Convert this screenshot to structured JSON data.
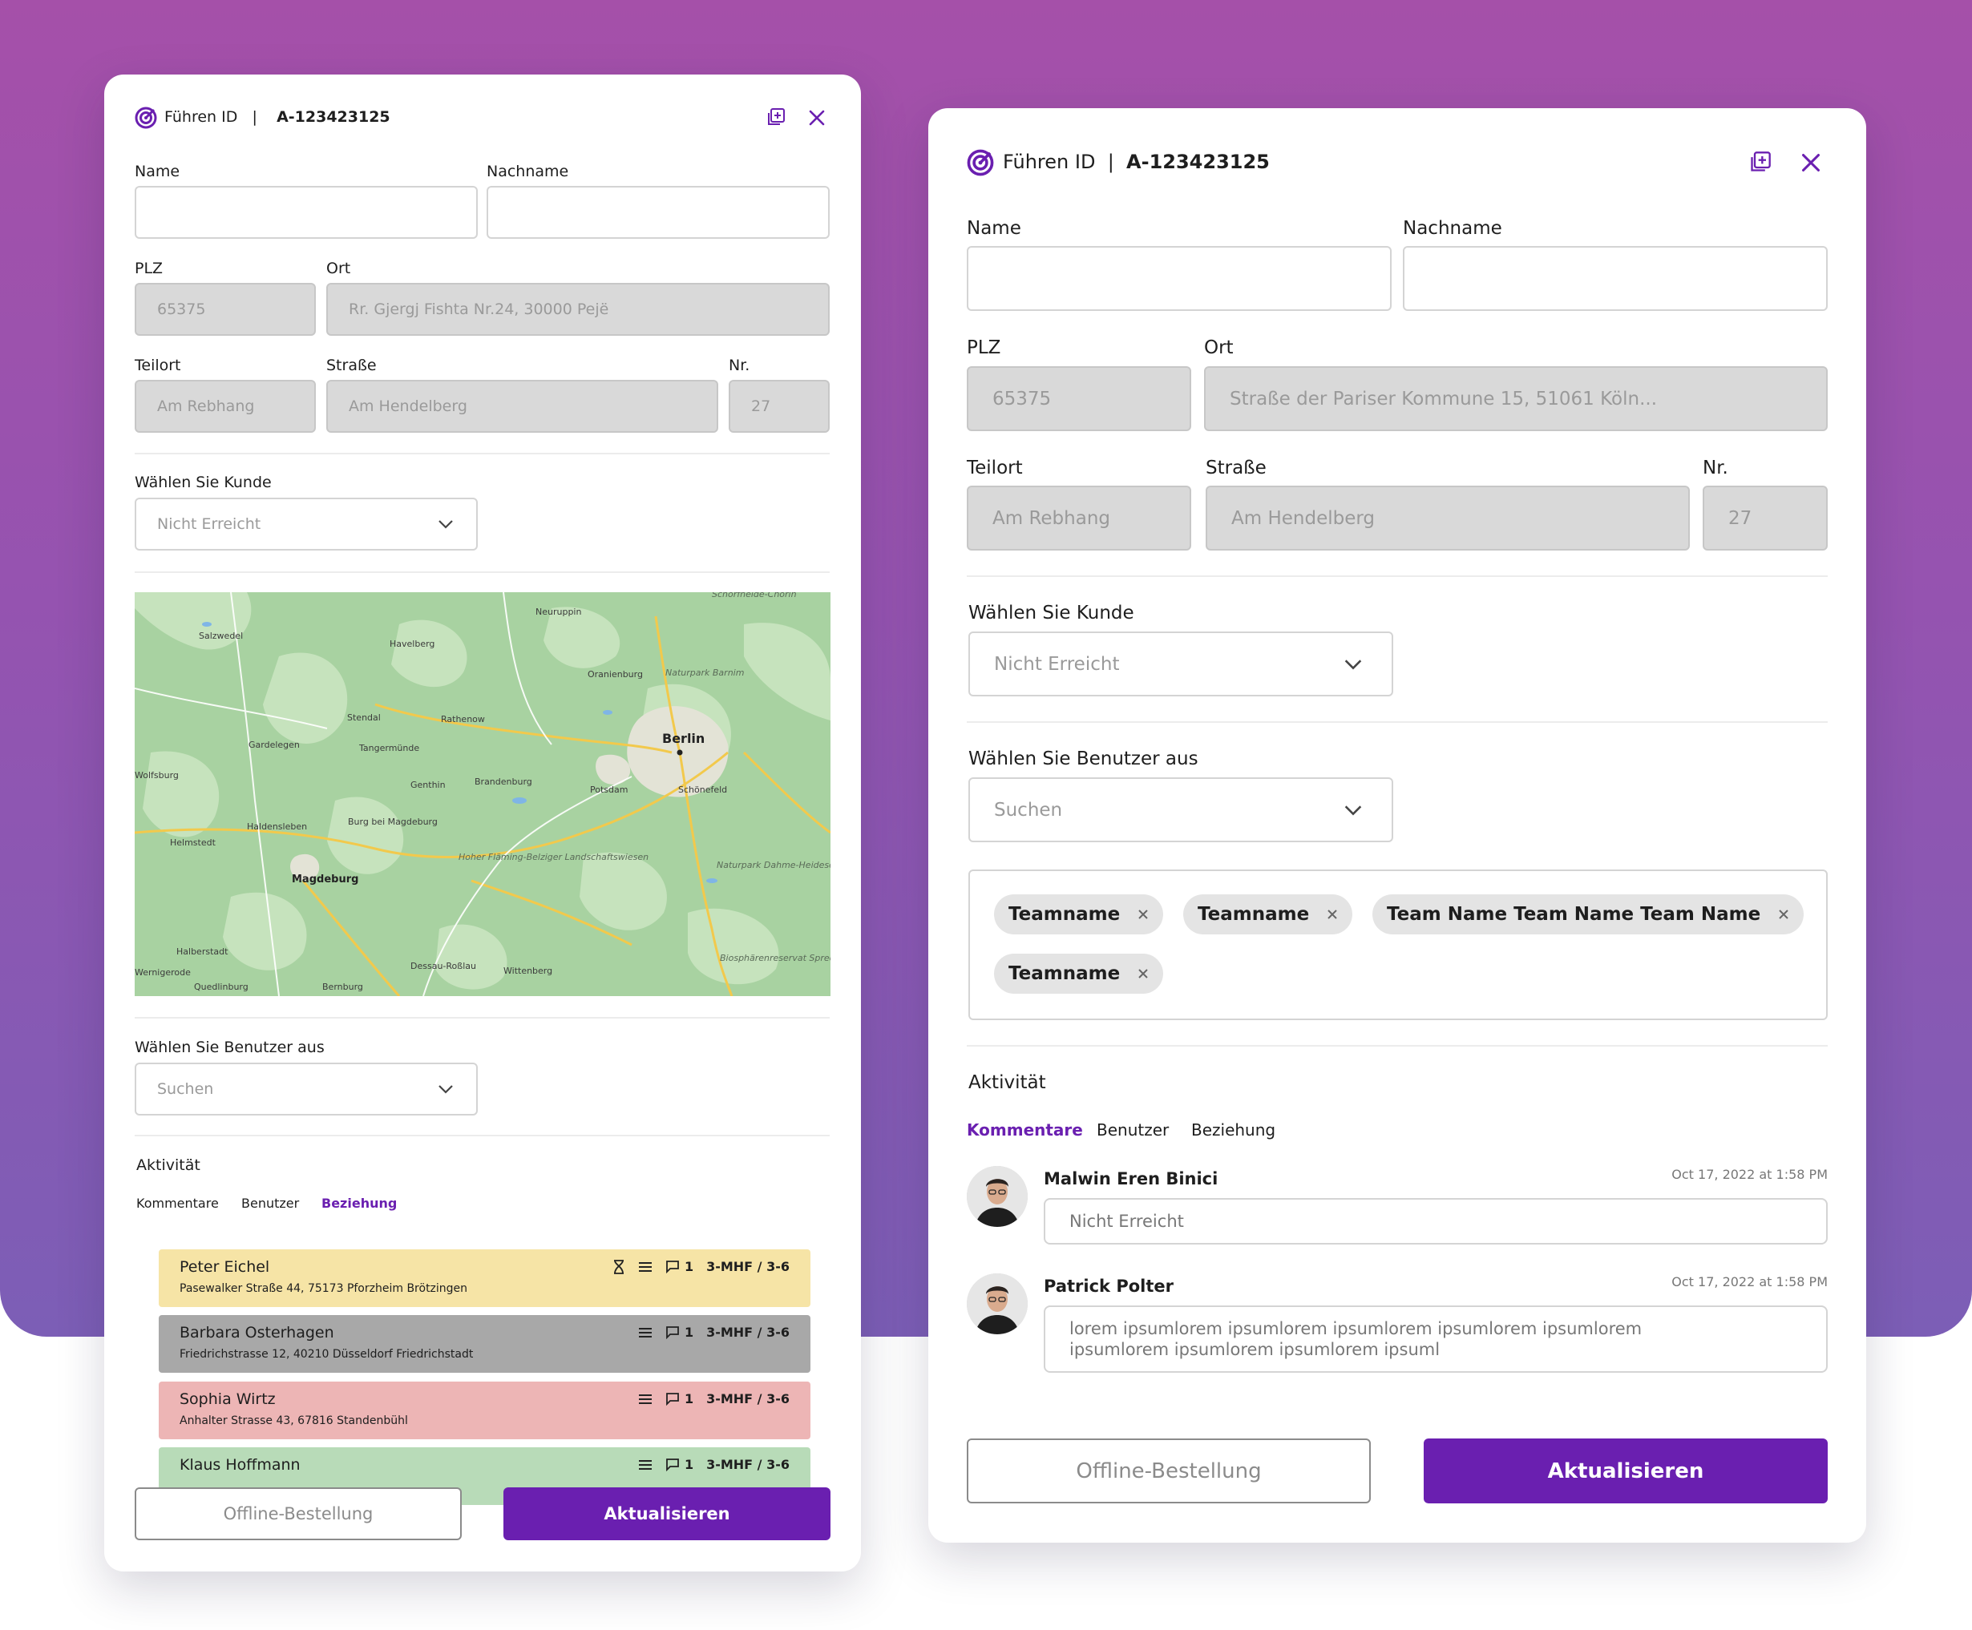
{
  "brand": {
    "accent": "#6a1fb0",
    "bg_gradient_top": "#a550a9",
    "bg_gradient_bottom": "#7c5eb6"
  },
  "panel_left": {
    "header": {
      "label": "Führen ID",
      "separator": "|",
      "id": "A-123423125"
    },
    "fields": {
      "name_label": "Name",
      "name_value": "",
      "nachname_label": "Nachname",
      "nachname_value": "",
      "plz_label": "PLZ",
      "plz_value": "65375",
      "ort_label": "Ort",
      "ort_value": "Rr. Gjergj Fishta Nr.24, 30000 Pejë",
      "teilort_label": "Teilort",
      "teilort_value": "Am Rebhang",
      "strasse_label": "Straße",
      "strasse_value": "Am Hendelberg",
      "nr_label": "Nr.",
      "nr_value": "27"
    },
    "kunde": {
      "label": "Wählen Sie Kunde",
      "value": "Nicht Erreicht"
    },
    "map": {
      "places": [
        "Schorfheide-Chorin",
        "Neuruppin",
        "Salzwedel",
        "Havelberg",
        "Oranienburg",
        "Naturpark Barnim",
        "Stendal",
        "Rathenow",
        "Berlin",
        "Gardelegen",
        "Tangermünde",
        "Wolfsburg",
        "Genthin",
        "Brandenburg",
        "Potsdam",
        "Schönefeld",
        "Haldensleben",
        "Burg bei Magdeburg",
        "Helmstedt",
        "Hoher Fläming-Belziger Landschaftswiesen",
        "Naturpark Dahme-Heideseen",
        "Magdeburg",
        "Halberstadt",
        "Dessau-Roßlau",
        "Wittenberg",
        "Biosphärenreservat Spreewald",
        "Wernigerode",
        "Quedlinburg",
        "Bernburg"
      ]
    },
    "benutzer": {
      "label": "Wählen Sie Benutzer aus",
      "placeholder": "Suchen"
    },
    "aktivitaet": {
      "title": "Aktivität",
      "tabs": [
        {
          "label": "Kommentare",
          "active": false
        },
        {
          "label": "Benutzer",
          "active": false
        },
        {
          "label": "Beziehung",
          "active": true
        }
      ],
      "cards": [
        {
          "name": "Peter Eichel",
          "address": "Pasewalker Straße 44, 75173 Pforzheim Brötzingen",
          "count": "1",
          "code": "3-MHF / 3-6",
          "color": "#f6e4a6",
          "hourglass": true
        },
        {
          "name": "Barbara Osterhagen",
          "address": "Friedrichstrasse 12, 40210 Düsseldorf Friedrichstadt",
          "count": "1",
          "code": "3-MHF / 3-6",
          "color": "#a8a8a8",
          "hourglass": false
        },
        {
          "name": "Sophia Wirtz",
          "address": "Anhalter Strasse 43, 67816 Standenbühl",
          "count": "1",
          "code": "3-MHF / 3-6",
          "color": "#edb5b5",
          "hourglass": false
        },
        {
          "name": "Klaus Hoffmann",
          "address": "",
          "count": "1",
          "code": "3-MHF / 3-6",
          "color": "#b8dbb8",
          "hourglass": false
        }
      ]
    },
    "buttons": {
      "offline": "Offline-Bestellung",
      "update": "Aktualisieren"
    }
  },
  "panel_right": {
    "header": {
      "label": "Führen ID",
      "separator": "|",
      "id": "A-123423125"
    },
    "fields": {
      "name_label": "Name",
      "name_value": "",
      "nachname_label": "Nachname",
      "nachname_value": "",
      "plz_label": "PLZ",
      "plz_value": "65375",
      "ort_label": "Ort",
      "ort_value": "Straße der Pariser Kommune 15, 51061 Köln...",
      "teilort_label": "Teilort",
      "teilort_value": "Am Rebhang",
      "strasse_label": "Straße",
      "strasse_value": "Am Hendelberg",
      "nr_label": "Nr.",
      "nr_value": "27"
    },
    "kunde": {
      "label": "Wählen Sie Kunde",
      "value": "Nicht Erreicht"
    },
    "benutzer": {
      "label": "Wählen Sie Benutzer aus",
      "placeholder": "Suchen"
    },
    "teams": [
      "Teamname",
      "Teamname",
      "Team Name Team Name Team Name",
      "Teamname"
    ],
    "aktivitaet": {
      "title": "Aktivität",
      "tabs": [
        {
          "label": "Kommentare",
          "active": true
        },
        {
          "label": "Benutzer",
          "active": false
        },
        {
          "label": "Beziehung",
          "active": false
        }
      ],
      "comments": [
        {
          "author": "Malwin Eren Binici",
          "time": "Oct 17, 2022 at 1:58 PM",
          "text": "Nicht Erreicht"
        },
        {
          "author": "Patrick Polter",
          "time": "Oct 17, 2022 at 1:58 PM",
          "text": "lorem ipsumlorem ipsumlorem ipsumlorem ipsumlorem ipsumlorem ipsumlorem ipsumlorem ipsumlorem ipsuml"
        }
      ]
    },
    "buttons": {
      "offline": "Offline-Bestellung",
      "update": "Aktualisieren"
    }
  }
}
